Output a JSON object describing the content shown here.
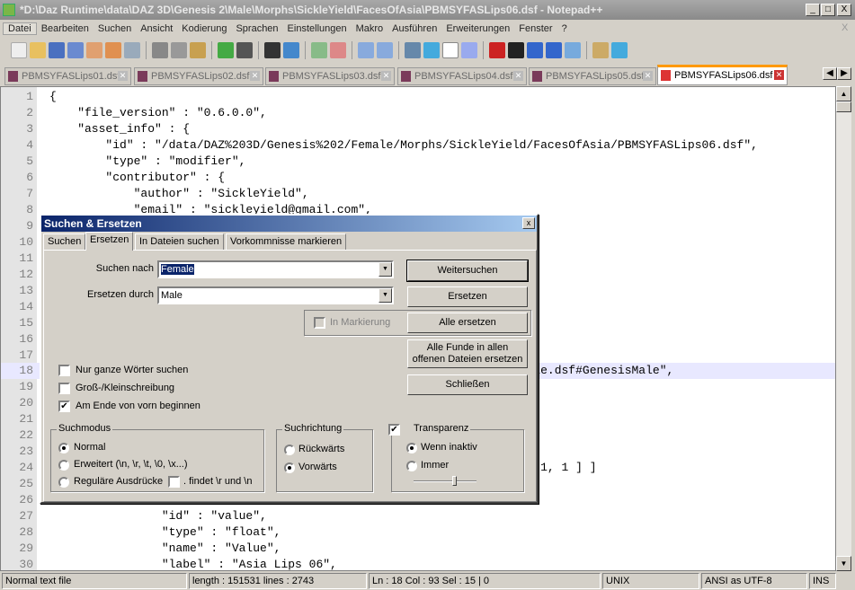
{
  "window": {
    "title": "*D:\\Daz Runtime\\data\\DAZ 3D\\Genesis 2\\Male\\Morphs\\SickleYield\\FacesOfAsia\\PBMSYFASLips06.dsf - Notepad++",
    "minimize": "_",
    "maximize": "□",
    "close": "X"
  },
  "menu": [
    "Datei",
    "Bearbeiten",
    "Suchen",
    "Ansicht",
    "Kodierung",
    "Sprachen",
    "Einstellungen",
    "Makro",
    "Ausführen",
    "Erweiterungen",
    "Fenster",
    "?"
  ],
  "menu_close": "X",
  "tabs": [
    "PBMSYFASLips01.dsf",
    "PBMSYFASLips02.dsf",
    "PBMSYFASLips03.dsf",
    "PBMSYFASLips04.dsf",
    "PBMSYFASLips05.dsf",
    "PBMSYFASLips06.dsf"
  ],
  "active_tab": 5,
  "editor": {
    "lines": [
      {
        "n": "1",
        "t": "{"
      },
      {
        "n": "2",
        "t": "    \"file_version\" : \"0.6.0.0\","
      },
      {
        "n": "3",
        "t": "    \"asset_info\" : {"
      },
      {
        "n": "4",
        "t": "        \"id\" : \"/data/DAZ%203D/Genesis%202/Female/Morphs/SickleYield/FacesOfAsia/PBMSYFASLips06.dsf\","
      },
      {
        "n": "5",
        "t": "        \"type\" : \"modifier\","
      },
      {
        "n": "6",
        "t": "        \"contributor\" : {"
      },
      {
        "n": "7",
        "t": "            \"author\" : \"SickleYield\","
      },
      {
        "n": "8",
        "t": "            \"email\" : \"sickleyield@gmail.com\","
      },
      {
        "n": "9",
        "t": ""
      },
      {
        "n": "10",
        "t": ""
      },
      {
        "n": "11",
        "t": ""
      },
      {
        "n": "12",
        "t": ""
      },
      {
        "n": "13",
        "t": ""
      },
      {
        "n": "14",
        "t": ""
      },
      {
        "n": "15",
        "t": ""
      },
      {
        "n": "16",
        "t": ""
      },
      {
        "n": "17",
        "t": ""
      },
      {
        "n": "18",
        "t": "                                                                   male.dsf#GenesisMale\","
      },
      {
        "n": "19",
        "t": ""
      },
      {
        "n": "20",
        "t": ""
      },
      {
        "n": "21",
        "t": ""
      },
      {
        "n": "22",
        "t": ""
      },
      {
        "n": "23",
        "t": ""
      },
      {
        "n": "24",
        "t": "                                                                   1, 1, 1 ] ]"
      },
      {
        "n": "25",
        "t": ""
      },
      {
        "n": "26",
        "t": ""
      },
      {
        "n": "27",
        "t": "                \"id\" : \"value\","
      },
      {
        "n": "28",
        "t": "                \"type\" : \"float\","
      },
      {
        "n": "29",
        "t": "                \"name\" : \"Value\","
      },
      {
        "n": "30",
        "t": "                \"label\" : \"Asia Lips 06\","
      }
    ],
    "current_line": 18
  },
  "status": {
    "type": "Normal text file",
    "length": "length : 151531    lines : 2743",
    "pos": "Ln : 18    Col : 93    Sel : 15 | 0",
    "eol": "UNIX",
    "enc": "ANSI as UTF-8",
    "mode": "INS"
  },
  "dialog": {
    "title": "Suchen & Ersetzen",
    "close": "x",
    "tabs": [
      "Suchen",
      "Ersetzen",
      "In Dateien suchen",
      "Vorkommnisse markieren"
    ],
    "find_label": "Suchen nach",
    "find_value": "Female",
    "replace_label": "Ersetzen durch",
    "replace_value": "Male",
    "btn_next": "Weitersuchen",
    "btn_replace": "Ersetzen",
    "btn_replace_all": "Alle ersetzen",
    "btn_all_files_1": "Alle Funde in allen",
    "btn_all_files_2": "offenen Dateien ersetzen",
    "btn_close": "Schließen",
    "in_selection": "In Markierung",
    "opt_whole": "Nur ganze Wörter suchen",
    "opt_case": "Groß-/Kleinschreibung",
    "opt_wrap": "Am Ende von vorn beginnen",
    "mode_title": "Suchmodus",
    "mode_normal": "Normal",
    "mode_ext": "Erweitert (\\n, \\r, \\t, \\0, \\x...)",
    "mode_regex": "Reguläre Ausdrücke",
    "dot_nl": ". findet \\r und \\n",
    "dir_title": "Suchrichtung",
    "dir_up": "Rückwärts",
    "dir_down": "Vorwärts",
    "trans_title": "Transparenz",
    "trans_inactive": "Wenn inaktiv",
    "trans_always": "Immer",
    "transparency_level": 0.65
  }
}
